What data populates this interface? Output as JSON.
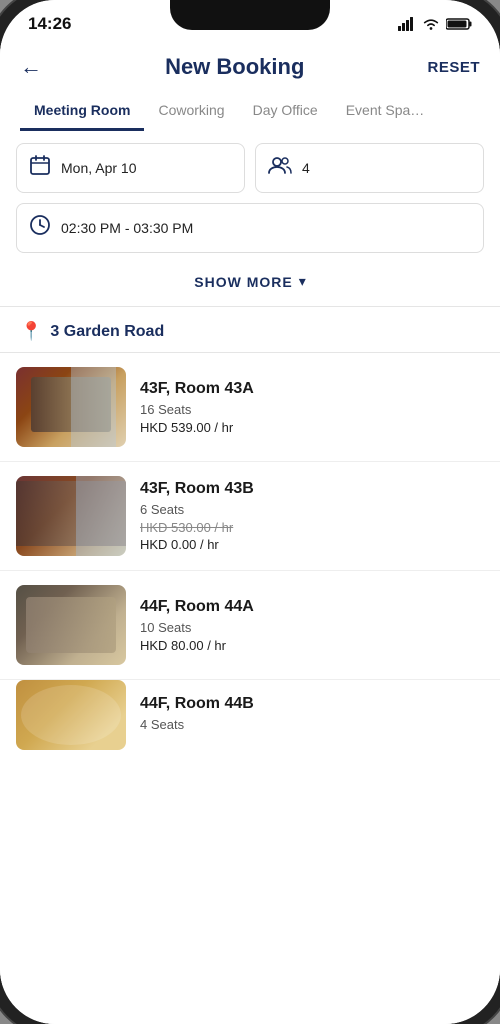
{
  "statusBar": {
    "time": "14:26",
    "icons": [
      "signal",
      "wifi",
      "battery"
    ]
  },
  "header": {
    "backLabel": "←",
    "title": "New Booking",
    "resetLabel": "RESET"
  },
  "tabs": [
    {
      "id": "meeting-room",
      "label": "Meeting Room",
      "active": true
    },
    {
      "id": "coworking",
      "label": "Coworking",
      "active": false
    },
    {
      "id": "day-office",
      "label": "Day Office",
      "active": false
    },
    {
      "id": "event-space",
      "label": "Event Spa…",
      "active": false
    }
  ],
  "filters": {
    "date": "Mon, Apr 10",
    "guests": "4",
    "time": "02:30 PM - 03:30 PM",
    "showMoreLabel": "SHOW MORE"
  },
  "location": {
    "name": "3 Garden Road"
  },
  "rooms": [
    {
      "id": "room-43a",
      "name": "43F, Room 43A",
      "seats": "16 Seats",
      "price": "HKD 539.00 / hr",
      "originalPrice": null,
      "imgClass": "room-img-1"
    },
    {
      "id": "room-43b",
      "name": "43F, Room 43B",
      "seats": "6 Seats",
      "price": "HKD 0.00 / hr",
      "originalPrice": "HKD 530.00 / hr",
      "imgClass": "room-img-2"
    },
    {
      "id": "room-44a",
      "name": "44F, Room 44A",
      "seats": "10 Seats",
      "price": "HKD 80.00 / hr",
      "originalPrice": null,
      "imgClass": "room-img-3"
    },
    {
      "id": "room-44b",
      "name": "44F, Room 44B",
      "seats": "4 Seats",
      "price": "",
      "originalPrice": null,
      "imgClass": "room-img-4",
      "partial": true
    }
  ]
}
